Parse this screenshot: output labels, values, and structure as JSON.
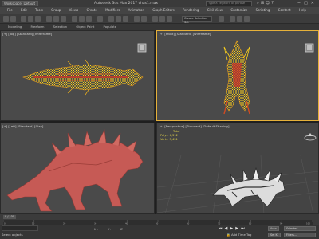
{
  "titlebar": {
    "workspace": "Workspace: Default",
    "title": "Autodesk 3ds Max 2017    chas1.max",
    "search_placeholder": "Type a keyword or phrase",
    "window_controls": [
      "−",
      "□",
      "✕"
    ]
  },
  "menu": [
    "File",
    "Edit",
    "Tools",
    "Group",
    "Views",
    "Create",
    "Modifiers",
    "Animation",
    "Graph Editors",
    "Rendering",
    "Civil View",
    "Customize",
    "Scripting",
    "Content",
    "Help"
  ],
  "toolbar": {
    "selection_set": "Create Selection Set"
  },
  "ribbon": [
    "Modeling",
    "Freeform",
    "Selection",
    "Object Paint",
    "Populate"
  ],
  "viewports": {
    "top": {
      "label": "[+] [Top] [Standard] [Wireframe]"
    },
    "front": {
      "label": "[+] [Front] [Standard] [Wireframe]"
    },
    "left": {
      "label": "[+] [Left] [Standard] [Clay]"
    },
    "perspective": {
      "label": "[+] [Perspective] [Standard] [Default Shading]",
      "stats_title": "Total",
      "polys_label": "Polys:",
      "polys_value": "6,312",
      "verts_label": "Verts:",
      "verts_value": "3,431"
    }
  },
  "timeline": {
    "frame": "0 / 100",
    "ticks": [
      "0",
      "10",
      "20",
      "30",
      "40",
      "50",
      "60",
      "70",
      "80",
      "90",
      "100"
    ]
  },
  "status": {
    "message": "Select objects",
    "x_label": "X:",
    "y_label": "Y:",
    "z_label": "Z:",
    "add_time_tag": "Add Time Tag",
    "auto_key": "Auto",
    "set_key": "Set K.",
    "key_filter": "Selected",
    "filters": "Filters..."
  },
  "colors": {
    "active_border": "#e6b13a",
    "wire": "#e8c21a",
    "clay": "#c65a55"
  }
}
